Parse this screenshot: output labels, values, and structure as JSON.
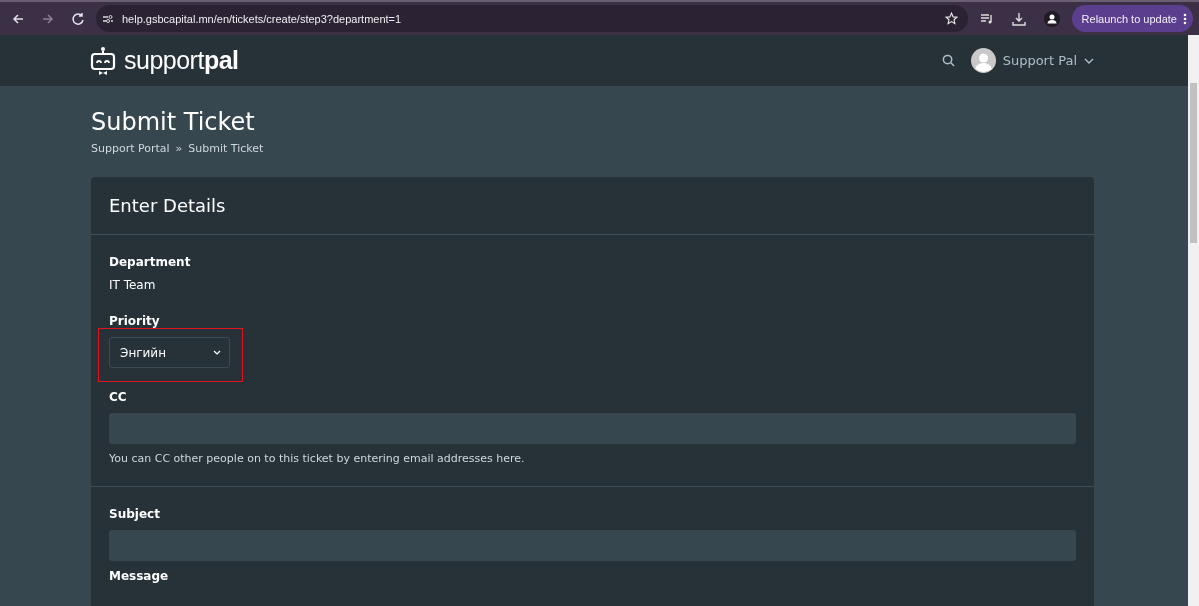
{
  "browser": {
    "url": "help.gsbcapital.mn/en/tickets/create/step3?department=1",
    "update_button": "Relaunch to update"
  },
  "header": {
    "logo": "support**pal**",
    "user": "Support Pal"
  },
  "page": {
    "title": "Submit Ticket",
    "breadcrumbs": [
      "Support Portal",
      "»",
      "Submit Ticket"
    ]
  },
  "card": {
    "title": "Enter Details",
    "fields": [
      {
        "kind": "static",
        "label": "Department",
        "value": "IT Team"
      },
      {
        "kind": "select",
        "label": "Priority",
        "value": "Энгийн",
        "highlighted": true
      },
      {
        "kind": "input",
        "label": "CC",
        "help": "You can CC other people on to this ticket by entering email addresses here."
      },
      {
        "kind": "divider"
      },
      {
        "kind": "input",
        "label": "Subject"
      },
      {
        "kind": "label",
        "label": "Message"
      }
    ]
  }
}
